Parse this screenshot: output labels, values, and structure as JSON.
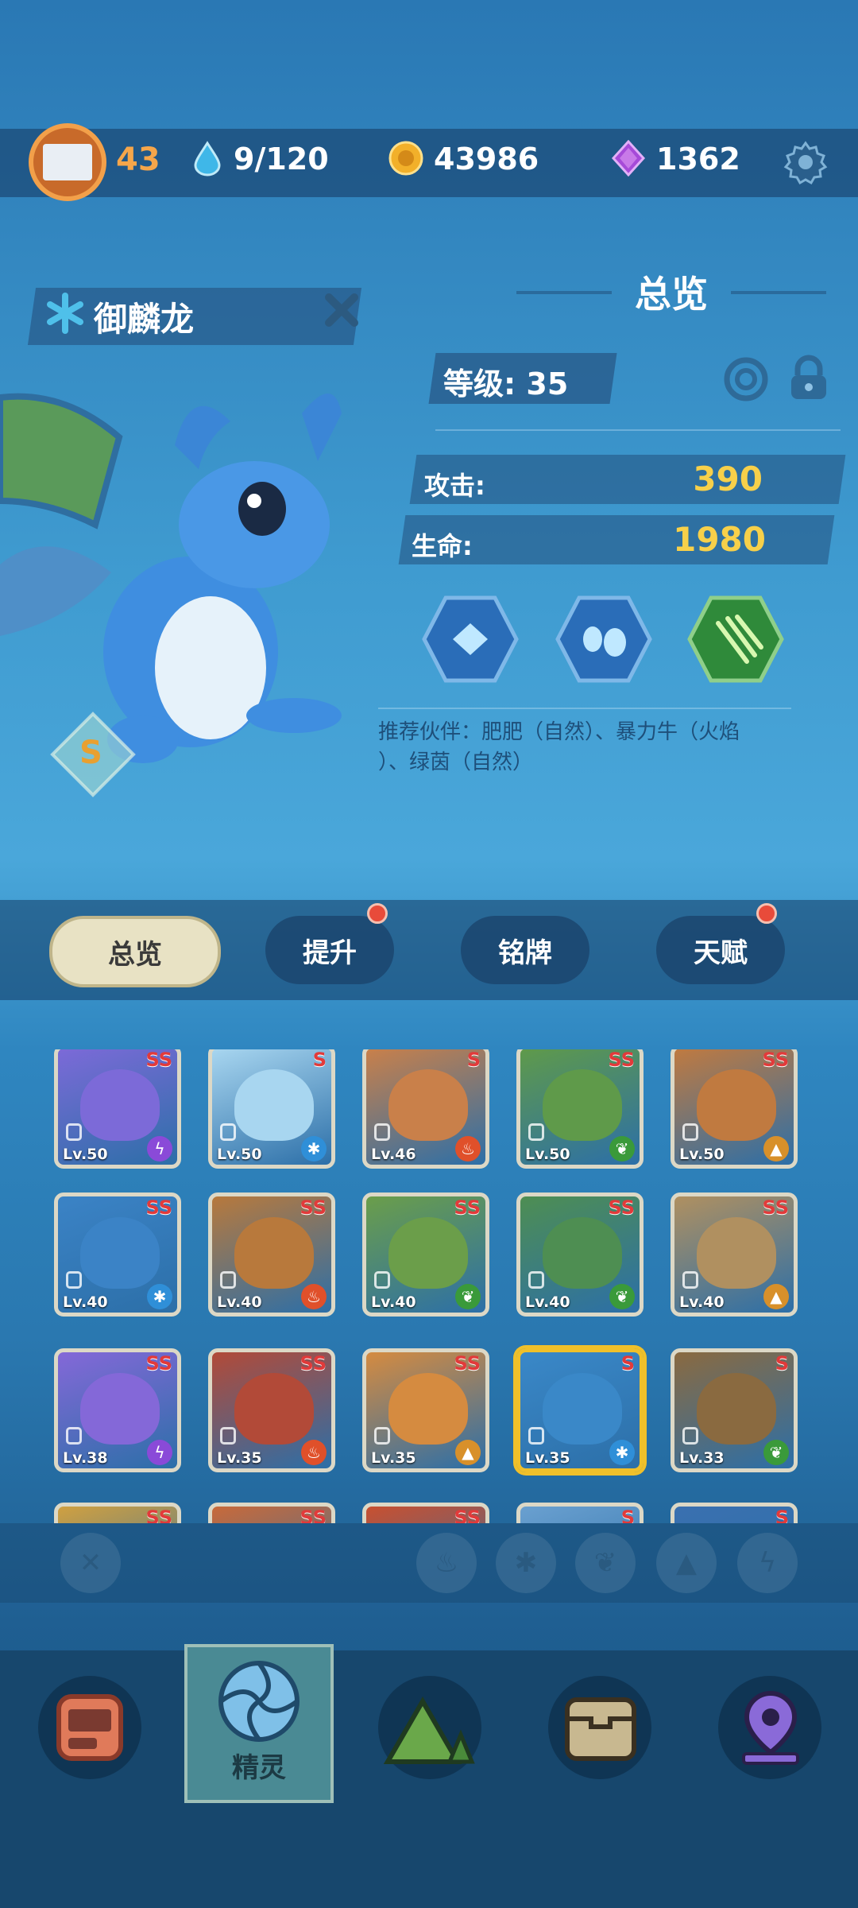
{
  "player": {
    "level": "43"
  },
  "resources": {
    "stamina": "9/120",
    "coins": "43986",
    "gems": "1362"
  },
  "creature": {
    "name": "御麟龙",
    "rank": "S",
    "element_icon": "snowflake-icon"
  },
  "overview": {
    "title": "总览",
    "level_label": "等级: 35",
    "attack_label": "攻击:",
    "attack_value": "390",
    "hp_label": "生命:",
    "hp_value": "1980",
    "recommend_line1": "推荐伙伴：肥肥（自然）、暴力牛（火焰",
    "recommend_line2": "）、绿茵（自然）"
  },
  "skills": [
    {
      "icon": "ice-crystal-icon",
      "color": "#2a6db8"
    },
    {
      "icon": "water-drops-icon",
      "color": "#2a6db8"
    },
    {
      "icon": "nature-claw-icon",
      "color": "#2f8a3a"
    }
  ],
  "tabs": [
    {
      "label": "总览",
      "active": true,
      "badge": false
    },
    {
      "label": "提升",
      "active": false,
      "badge": true
    },
    {
      "label": "铭牌",
      "active": false,
      "badge": false
    },
    {
      "label": "天赋",
      "active": false,
      "badge": true
    }
  ],
  "cards": [
    {
      "lv": "Lv.50",
      "rank": "SS",
      "element": "thunder",
      "bg": "#7c6ad8"
    },
    {
      "lv": "Lv.50",
      "rank": "S",
      "element": "ice",
      "bg": "#a8d6f0"
    },
    {
      "lv": "Lv.46",
      "rank": "S",
      "element": "fire",
      "bg": "#c9804a"
    },
    {
      "lv": "Lv.50",
      "rank": "SS",
      "element": "nature",
      "bg": "#5f9a4a"
    },
    {
      "lv": "Lv.50",
      "rank": "SS",
      "element": "earth",
      "bg": "#c07a40"
    },
    {
      "lv": "Lv.40",
      "rank": "SS",
      "element": "ice",
      "bg": "#3b83c6"
    },
    {
      "lv": "Lv.40",
      "rank": "SS",
      "element": "fire",
      "bg": "#b8793c"
    },
    {
      "lv": "Lv.40",
      "rank": "SS",
      "element": "nature",
      "bg": "#6b9e4a"
    },
    {
      "lv": "Lv.40",
      "rank": "SS",
      "element": "nature",
      "bg": "#4e8e52"
    },
    {
      "lv": "Lv.40",
      "rank": "SS",
      "element": "earth",
      "bg": "#b09060"
    },
    {
      "lv": "Lv.38",
      "rank": "SS",
      "element": "thunder",
      "bg": "#8468d8"
    },
    {
      "lv": "Lv.35",
      "rank": "SS",
      "element": "fire",
      "bg": "#b24a38"
    },
    {
      "lv": "Lv.35",
      "rank": "SS",
      "element": "earth",
      "bg": "#d58b40"
    },
    {
      "lv": "Lv.35",
      "rank": "S",
      "element": "ice",
      "bg": "#3a88c8",
      "selected": true
    },
    {
      "lv": "Lv.33",
      "rank": "S",
      "element": "nature",
      "bg": "#8a6a40"
    },
    {
      "lv": "",
      "rank": "SS",
      "element": "",
      "bg": "#d0a040"
    },
    {
      "lv": "",
      "rank": "SS",
      "element": "",
      "bg": "#c86a3a"
    },
    {
      "lv": "",
      "rank": "SS",
      "element": "",
      "bg": "#c85030"
    },
    {
      "lv": "",
      "rank": "S",
      "element": "",
      "bg": "#6aa0d0"
    },
    {
      "lv": "",
      "rank": "S",
      "element": "",
      "bg": "#3a70b0"
    }
  ],
  "filters": [
    {
      "icon": "clear-filter-icon"
    },
    {
      "icon": "fire-icon"
    },
    {
      "icon": "ice-icon"
    },
    {
      "icon": "leaf-icon"
    },
    {
      "icon": "earth-icon"
    },
    {
      "icon": "thunder-icon"
    }
  ],
  "nav": {
    "active_label": "精灵"
  },
  "colors": {
    "gold": "#f7d04a",
    "accent_orange": "#f6a64a",
    "badge_red": "#e84b3a"
  }
}
